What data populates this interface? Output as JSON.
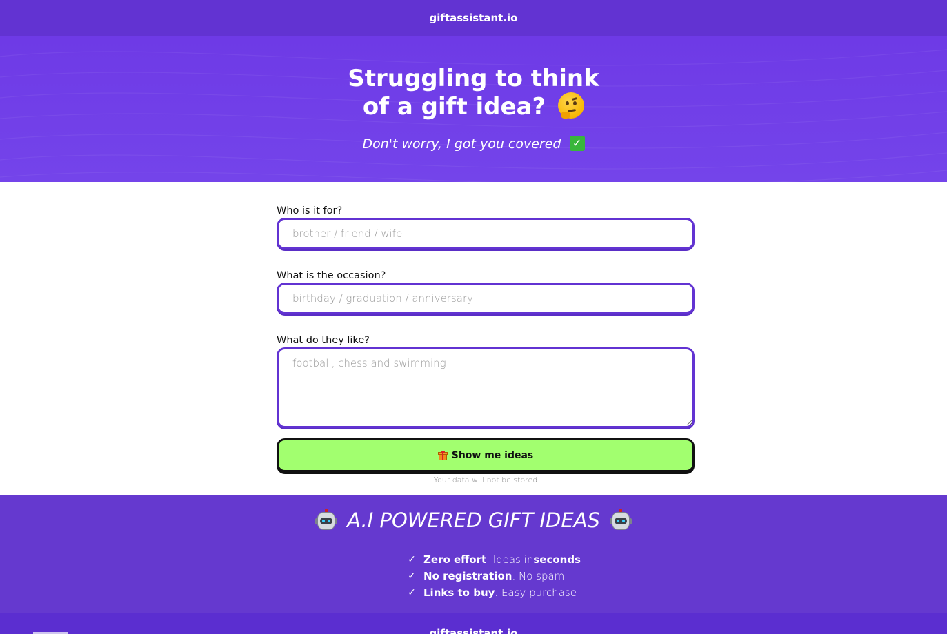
{
  "header": {
    "brand": "giftassistant.io"
  },
  "hero": {
    "title_line1": "Struggling to think",
    "title_line2": "of a gift idea?",
    "title_emoji": "thinking-face",
    "subtitle": "Don't worry, I got you covered",
    "subtitle_emoji": "check-mark-button"
  },
  "form": {
    "who": {
      "label": "Who is it for?",
      "placeholder": "brother / friend / wife",
      "value": ""
    },
    "occasion": {
      "label": "What is the occasion?",
      "placeholder": "birthday / graduation / anniversary",
      "value": ""
    },
    "likes": {
      "label": "What do they like?",
      "placeholder": "football, chess and swimming",
      "value": ""
    },
    "submit_label": "Show me ideas",
    "submit_icon": "gift",
    "privacy_note": "Your data will not be stored"
  },
  "features": {
    "title": "A.I POWERED GIFT IDEAS",
    "title_icon": "robot",
    "items": [
      {
        "bold": "Zero effort",
        "rest": ". Ideas in ",
        "bold2": "seconds"
      },
      {
        "bold": "No registration",
        "rest": ". No spam",
        "bold2": ""
      },
      {
        "bold": "Links to buy",
        "rest": ". Easy purchase",
        "bold2": ""
      }
    ]
  },
  "footer": {
    "brand": "giftassistant.io"
  },
  "colors": {
    "brand_purple": "#6233d2",
    "hero_purple": "#7444ea",
    "button_green": "#a2ff6f"
  }
}
